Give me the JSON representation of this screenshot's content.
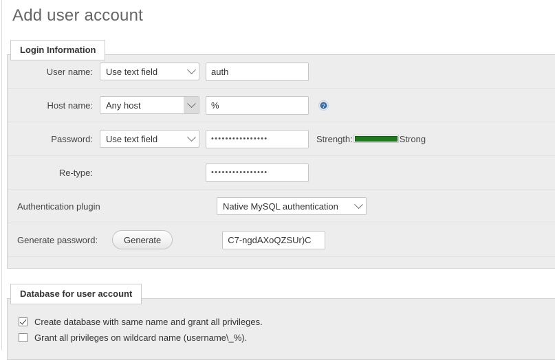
{
  "page": {
    "title": "Add user account"
  },
  "login_section": {
    "legend": "Login Information",
    "rows": {
      "username": {
        "label": "User name:",
        "select_value": "Use text field",
        "input_value": "auth"
      },
      "hostname": {
        "label": "Host name:",
        "select_value": "Any host",
        "input_value": "%",
        "help_icon": "help-circle-icon"
      },
      "password": {
        "label": "Password:",
        "select_value": "Use text field",
        "input_value": "••••••••••••••••",
        "strength_label": "Strength:",
        "strength_value": "Strong",
        "strength_percent": 100,
        "strength_color": "#1f7a1f"
      },
      "retype": {
        "label": "Re-type:",
        "input_value": "••••••••••••••••"
      },
      "auth_plugin": {
        "label": "Authentication plugin",
        "select_value": "Native MySQL authentication"
      },
      "generate_password": {
        "label": "Generate password:",
        "button_label": "Generate",
        "generated_value": "C7-ngdAXoQZSUr)C"
      }
    }
  },
  "database_section": {
    "legend": "Database for user account",
    "checkboxes": [
      {
        "label": "Create database with same name and grant all privileges.",
        "checked": true
      },
      {
        "label": "Grant all privileges on wildcard name (username\\_%).",
        "checked": false
      }
    ]
  }
}
